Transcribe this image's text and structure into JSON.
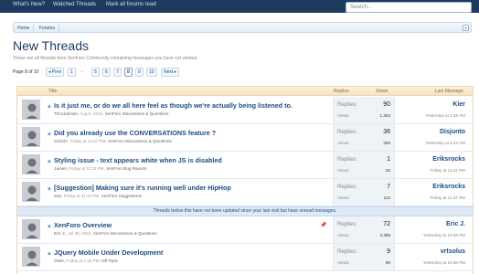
{
  "topnav": {
    "tabs": [
      "What's New?",
      "Watched Threads",
      "Mark all forums read"
    ],
    "search_placeholder": "Search..."
  },
  "breadcrumb": [
    "Home",
    "Forums"
  ],
  "page": {
    "title": "New Threads",
    "subtitle": "These are all threads from XenForo Community containing messages you have not viewed."
  },
  "pagination": {
    "label": "Page 8 of 10",
    "prev": "◂ Prev",
    "first": "1",
    "ellipsis": "←",
    "pages": [
      "5",
      "6",
      "7",
      "8",
      "9",
      "10"
    ],
    "current": "8",
    "next": "Next ▸"
  },
  "columns": {
    "title": "Title",
    "replies": "Replies",
    "views": "Views",
    "last_message": "Last Message"
  },
  "stat_labels": {
    "replies": "Replies:",
    "views": "Views:"
  },
  "unread_note": "Threads below this have not been updated since your last visit but have unread messages.",
  "threads": [
    {
      "title": "Is it just me, or do we all here feel as though we're actually being listened to.",
      "author": "ThCclubman,",
      "date": "Aug 6, 2010,",
      "forum": "XenForo Discussions & Questions",
      "replies": "90",
      "views": "1,304",
      "last_user": "Kier",
      "last_time": "Yesterday at 2:36 AM",
      "sticky": false
    },
    {
      "title": "Did you already use the CONVERSATIONS feature ?",
      "author": "erich37,",
      "date": "Friday at 12:37 PM,",
      "forum": "XenForo Discussions & Questions",
      "replies": "36",
      "views": "300",
      "last_user": "Disjunto",
      "last_time": "Yesterday at 2:23 AM",
      "sticky": false
    },
    {
      "title": "Styling issue - text appears white when JS is disabled",
      "author": "James,",
      "date": "Friday at 11:23 PM,",
      "forum": "XenForo Bug Reports",
      "replies": "1",
      "views": "33",
      "last_user": "Eriksrocks",
      "last_time": "Friday at 11:41 PM",
      "sticky": false
    },
    {
      "title": "[Suggestion] Making sure it's running well under HipHop",
      "author": "eisx,",
      "date": "Friday at 11:10 PM,",
      "forum": "XenForo Suggestions",
      "replies": "7",
      "views": "114",
      "last_user": "Eriksrocks",
      "last_time": "Friday at 11:37 PM",
      "sticky": false
    },
    {
      "title": "XenForo Overview",
      "author": "Eric J.,",
      "date": "Jul 30, 2010,",
      "forum": "XenForo Discussions & Questions",
      "replies": "72",
      "views": "3,389",
      "last_user": "Eric J.",
      "last_time": "Yesterday at 10:09 PM",
      "sticky": true
    },
    {
      "title": "JQuery Mobile Under Development",
      "author": "GetD,",
      "date": "Friday at 1:32 PM,",
      "forum": "Off Topic",
      "replies": "9",
      "views": "90",
      "last_user": "vrtsolus",
      "last_time": "Yesterday at 10:06 PM",
      "sticky": false
    }
  ],
  "colors": {
    "nav_bg": "#1d3a5f",
    "link": "#1d4d82",
    "header_bg": "#f7e3c0",
    "stats_bg": "#eef3f8",
    "note_bg": "#dfeaf6"
  }
}
